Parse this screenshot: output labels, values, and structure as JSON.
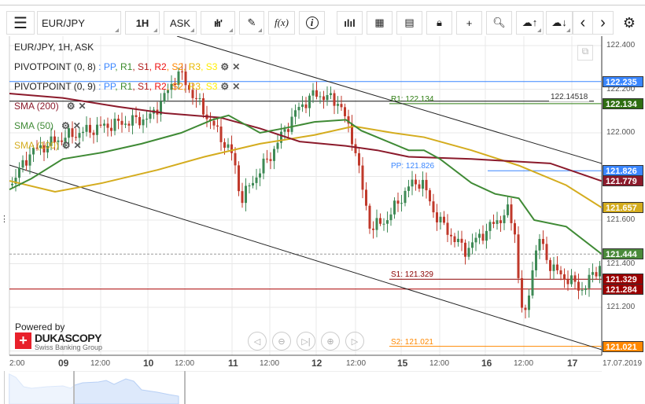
{
  "toolbar": {
    "symbol": "EUR/JPY",
    "timeframe": "1H",
    "side": "ASK",
    "fx_label": "f(x)",
    "info_label": "i",
    "prev": "‹",
    "next": "›"
  },
  "legend": {
    "title": "EUR/JPY, 1H, ASK",
    "pivot1": "PIVOTPOINT (0, 8)",
    "pivot2": "PIVOTPOINT (0, 9)",
    "pivot_parts": [
      {
        "t": ": PP",
        "c": "#3a86ff"
      },
      {
        "t": ", R1",
        "c": "#3a8a2a"
      },
      {
        "t": ", S1",
        "c": "#b01c1c"
      },
      {
        "t": ", R2",
        "c": "#ee1111"
      },
      {
        "t": ", S2",
        "c": "#ff8800"
      },
      {
        "t": ", R3",
        "c": "#e8b800"
      },
      {
        "t": ", S3",
        "c": "#ffee00"
      }
    ],
    "sma200": "SMA (200)",
    "sma50": "SMA (50)",
    "sma100": "SMA (100)"
  },
  "colors": {
    "sma200": "#8b1a2b",
    "sma50": "#3f8a35",
    "sma100": "#d4ac1e",
    "up": "#3e8a55",
    "down": "#c0392b",
    "pp": "#3a86ff",
    "r1": "#2e7d12",
    "s1": "#8b0000",
    "s2": "#ff8800"
  },
  "price_axis": {
    "ticks": [
      "122.400",
      "122.200",
      "122.000",
      "121.600",
      "121.400",
      "121.200"
    ]
  },
  "price_labels": [
    {
      "text": "122.235",
      "price": 122.235,
      "bg": "#3a86ff"
    },
    {
      "text": "122.134",
      "price": 122.134,
      "bg": "#2e6e12"
    },
    {
      "text": "121.826",
      "price": 121.826,
      "bg": "#3a86ff"
    },
    {
      "text": "121.779",
      "price": 121.779,
      "bg": "#8b1a2b"
    },
    {
      "text": "121.657",
      "price": 121.657,
      "bg": "#d4ac1e"
    },
    {
      "text": "121.444",
      "price": 121.444,
      "bg": "#4a8a3a"
    },
    {
      "text": "121.329",
      "price": 121.329,
      "bg": "#9b0000"
    },
    {
      "text": "121.284",
      "price": 121.284,
      "bg": "#9b0000"
    },
    {
      "text": "121.021",
      "price": 121.021,
      "bg": "#ff8800"
    }
  ],
  "pivot_levels": {
    "r1": "R1: 122.134",
    "pp": "PP: 121.826",
    "s1": "S1: 121.329",
    "s2": "S2: 121.021",
    "hline": "122.14518"
  },
  "time_axis": [
    {
      "t": "2:00",
      "d": false
    },
    {
      "t": "09",
      "d": true
    },
    {
      "t": "12:00",
      "d": false
    },
    {
      "t": "10",
      "d": true
    },
    {
      "t": "12:00",
      "d": false
    },
    {
      "t": "11",
      "d": true
    },
    {
      "t": "12:00",
      "d": false
    },
    {
      "t": "12",
      "d": true
    },
    {
      "t": "12:00",
      "d": false
    },
    {
      "t": "15",
      "d": true
    },
    {
      "t": "12:00",
      "d": false
    },
    {
      "t": "16",
      "d": true
    },
    {
      "t": "12:00",
      "d": false
    },
    {
      "t": "17",
      "d": true
    },
    {
      "t": "17.07.2019",
      "d": false
    }
  ],
  "branding": {
    "powered": "Powered by",
    "name": "DUKASCOPY",
    "sub": "Swiss Banking Group"
  },
  "chart_data": {
    "type": "candlestick",
    "price_path": [
      [
        0,
        121.76
      ],
      [
        0.033,
        121.91
      ],
      [
        0.09,
        121.98
      ],
      [
        0.157,
        122.03
      ],
      [
        0.236,
        122.07
      ],
      [
        0.27,
        122.21
      ],
      [
        0.283,
        122.28
      ],
      [
        0.316,
        122.14
      ],
      [
        0.343,
        122.03
      ],
      [
        0.376,
        121.89
      ],
      [
        0.389,
        121.69
      ],
      [
        0.409,
        121.78
      ],
      [
        0.442,
        121.91
      ],
      [
        0.462,
        122.01
      ],
      [
        0.488,
        122.12
      ],
      [
        0.515,
        122.18
      ],
      [
        0.555,
        122.14
      ],
      [
        0.581,
        121.94
      ],
      [
        0.594,
        121.74
      ],
      [
        0.608,
        121.56
      ],
      [
        0.634,
        121.6
      ],
      [
        0.674,
        121.76
      ],
      [
        0.694,
        121.78
      ],
      [
        0.714,
        121.64
      ],
      [
        0.734,
        121.56
      ],
      [
        0.767,
        121.46
      ],
      [
        0.806,
        121.56
      ],
      [
        0.84,
        121.64
      ],
      [
        0.853,
        121.53
      ],
      [
        0.86,
        121.22
      ],
      [
        0.87,
        121.15
      ],
      [
        0.88,
        121.38
      ],
      [
        0.893,
        121.51
      ],
      [
        0.913,
        121.38
      ],
      [
        0.94,
        121.33
      ],
      [
        0.967,
        121.28
      ],
      [
        0.987,
        121.37
      ],
      [
        1,
        121.4
      ]
    ],
    "sma50": [
      [
        0,
        121.74
      ],
      [
        0.037,
        121.79
      ],
      [
        0.09,
        121.88
      ],
      [
        0.157,
        121.91
      ],
      [
        0.223,
        121.95
      ],
      [
        0.29,
        122.0
      ],
      [
        0.343,
        122.06
      ],
      [
        0.37,
        122.08
      ],
      [
        0.423,
        122.0
      ],
      [
        0.462,
        122.02
      ],
      [
        0.515,
        122.05
      ],
      [
        0.568,
        122.06
      ],
      [
        0.594,
        122.01
      ],
      [
        0.674,
        121.92
      ],
      [
        0.7,
        121.92
      ],
      [
        0.727,
        121.88
      ],
      [
        0.78,
        121.77
      ],
      [
        0.82,
        121.72
      ],
      [
        0.86,
        121.7
      ],
      [
        0.886,
        121.6
      ],
      [
        0.94,
        121.57
      ],
      [
        1,
        121.444
      ]
    ],
    "sma200": [
      [
        0,
        122.18
      ],
      [
        0.09,
        122.16
      ],
      [
        0.183,
        122.12
      ],
      [
        0.263,
        122.09
      ],
      [
        0.356,
        122.07
      ],
      [
        0.423,
        122.02
      ],
      [
        0.49,
        121.96
      ],
      [
        0.568,
        121.94
      ],
      [
        0.621,
        121.92
      ],
      [
        0.674,
        121.89
      ],
      [
        0.78,
        121.88
      ],
      [
        0.913,
        121.86
      ],
      [
        1,
        121.779
      ]
    ],
    "sma100": [
      [
        0,
        121.78
      ],
      [
        0.077,
        121.73
      ],
      [
        0.157,
        121.77
      ],
      [
        0.25,
        121.83
      ],
      [
        0.329,
        121.89
      ],
      [
        0.423,
        121.95
      ],
      [
        0.515,
        121.99
      ],
      [
        0.581,
        122.03
      ],
      [
        0.647,
        122.0
      ],
      [
        0.7,
        121.98
      ],
      [
        0.78,
        121.92
      ],
      [
        0.86,
        121.85
      ],
      [
        0.94,
        121.76
      ],
      [
        1,
        121.657
      ]
    ],
    "ylim": [
      120.99,
      122.43
    ]
  }
}
